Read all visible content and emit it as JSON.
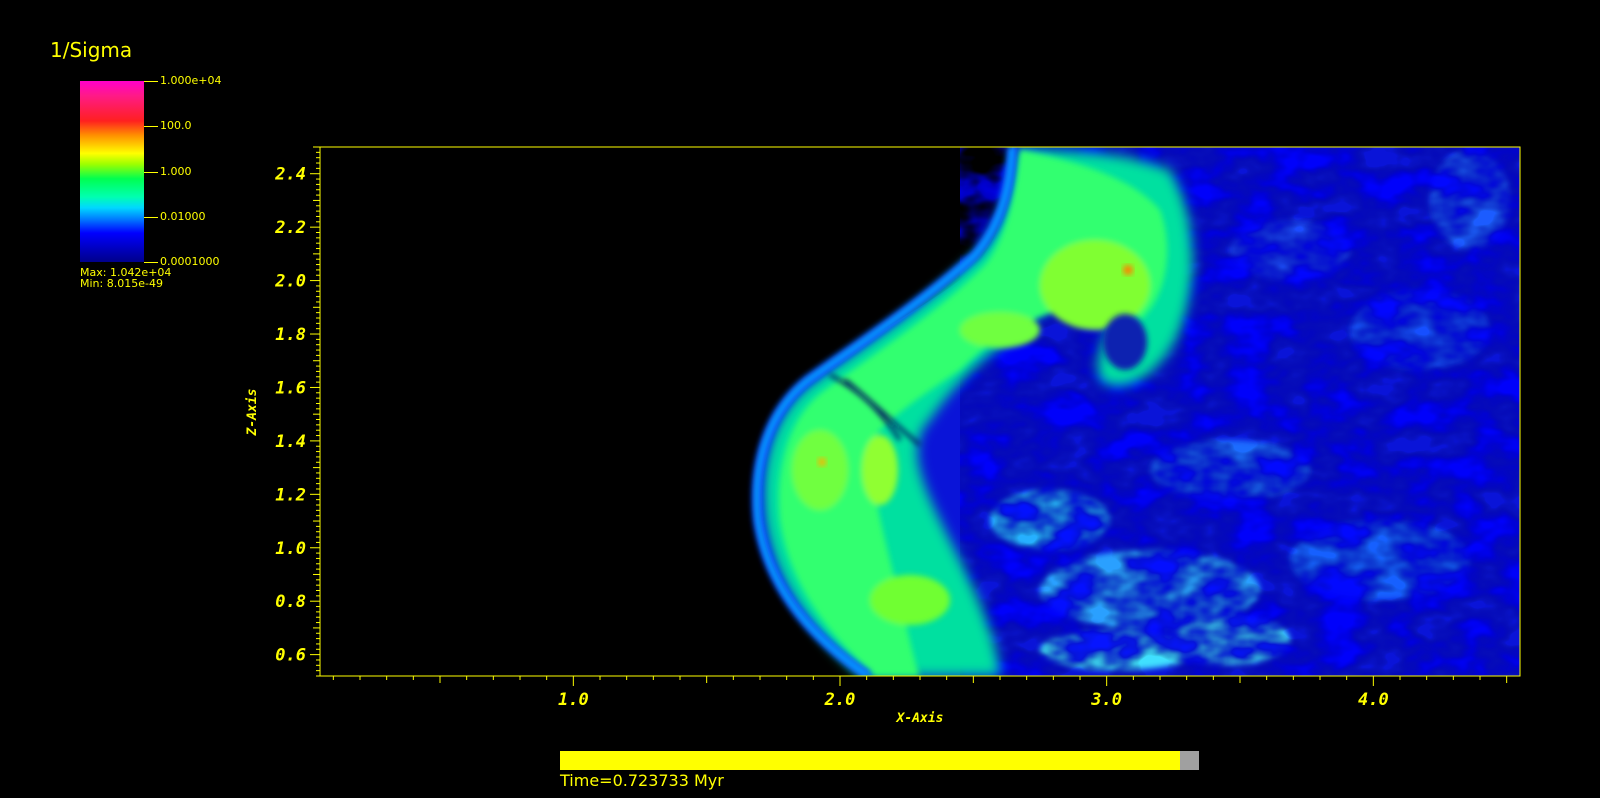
{
  "colorbar": {
    "title": "1/Sigma",
    "tick_labels": [
      "1.000e+04",
      "100.0",
      "1.000",
      "0.01000",
      "0.0001000"
    ],
    "max_label": "Max:  1.042e+04",
    "min_label": "Min:  8.015e-49"
  },
  "plot": {
    "xlabel": "X-Axis",
    "ylabel": "Z-Axis",
    "xlim": [
      0.05,
      4.55
    ],
    "ylim": [
      0.52,
      2.5
    ],
    "x_ticks": [
      "1.0",
      "2.0",
      "3.0",
      "4.0"
    ],
    "y_ticks": [
      "0.6",
      "0.8",
      "1.0",
      "1.2",
      "1.4",
      "1.6",
      "1.8",
      "2.0",
      "2.2",
      "2.4"
    ],
    "axis_color": "#ffff00",
    "background": "#000000"
  },
  "time": {
    "label": "Time=0.723733 Myr",
    "progress": 0.97
  },
  "colors": {
    "text": "#ffff00",
    "bar_track": "#a0a0a0"
  }
}
